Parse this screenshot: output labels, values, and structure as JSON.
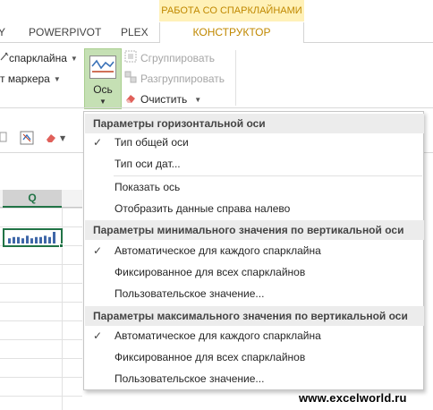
{
  "ribbon_tabs": {
    "context_group": "РАБОТА СО СПАРКЛАЙНАМИ",
    "partial_left": "Y",
    "powerpivot": "POWERPIVOT",
    "plex": "PLEX",
    "active": "КОНСТРУКТОР"
  },
  "ribbon": {
    "sparkline_data_partial": "спарклайна",
    "marker_color_partial": "т маркера",
    "axis_button": "Ось",
    "group": "Сгруппировать",
    "ungroup": "Разгруппировать",
    "clear": "Очистить",
    "group_disabled": true,
    "ungroup_disabled": true
  },
  "sheet": {
    "column_header": "Q",
    "accent_color": "#217346",
    "sparkline_values": [
      4,
      5,
      5,
      4,
      6,
      4,
      5,
      5,
      6,
      5,
      9
    ]
  },
  "axis_menu": {
    "sections": [
      {
        "header": "Параметры горизонтальной оси",
        "items": [
          {
            "label": "Тип общей оси",
            "checked": true
          },
          {
            "label": "Тип оси дат...",
            "checked": false
          },
          {
            "separator": true
          },
          {
            "label": "Показать ось",
            "checked": false
          },
          {
            "label": "Отобразить данные справа налево",
            "checked": false
          }
        ]
      },
      {
        "header": "Параметры минимального значения по вертикальной оси",
        "items": [
          {
            "label": "Автоматическое для каждого спарклайна",
            "checked": true
          },
          {
            "label": "Фиксированное для всех спарклайнов",
            "checked": false
          },
          {
            "label": "Пользовательское значение...",
            "checked": false
          }
        ]
      },
      {
        "header": "Параметры максимального значения по вертикальной оси",
        "items": [
          {
            "label": "Автоматическое для каждого спарклайна",
            "checked": true
          },
          {
            "label": "Фиксированное для всех спарклайнов",
            "checked": false
          },
          {
            "label": "Пользовательское значение...",
            "checked": false
          }
        ]
      }
    ],
    "check_glyph": "✓"
  },
  "watermark": "www.excelworld.ru"
}
